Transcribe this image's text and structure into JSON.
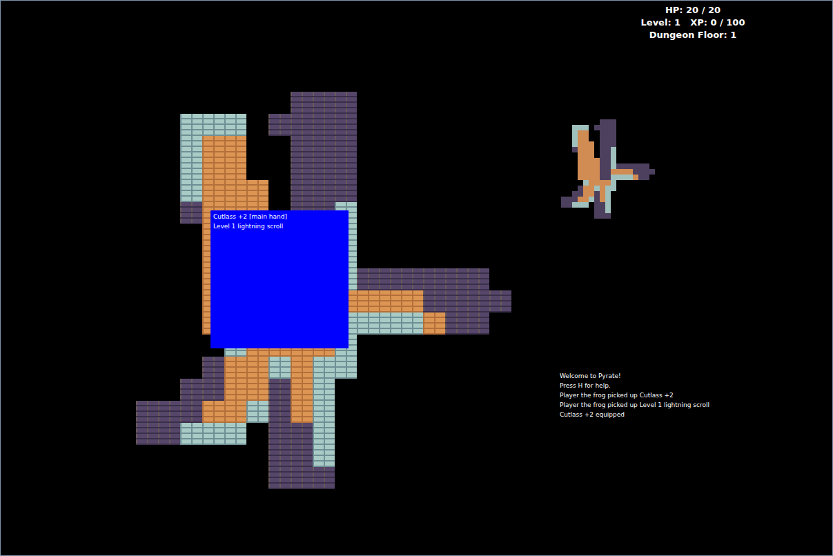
{
  "hud": {
    "hp": "HP: 20 / 20",
    "level": "Level: 1",
    "xp": "XP: 0 / 100",
    "floor": "Dungeon Floor: 1"
  },
  "map": {
    "legend": {
      "w": "wall",
      "f": "floor",
      "d": "dark",
      " ": "empty"
    },
    "rows": [
      "       ddd       ",
      "  www dddd       ",
      "  wff  ddd       ",
      "  wff  ddd       ",
      "  wfff ddd       ",
      "  dfff ddw       ",
      "   fff ddw       ",
      "   ffffddw       ",
      "   ffffddwdddddd ",
      "   ffffddffffdddd",
      "   ffffddwwwwfdd ",
      "    wffffw       ",
      "   dffwfww       ",
      "  ddffdfw        ",
      "dddffwdfw        ",
      "ddwww ddw        ",
      "      ddw        ",
      "      ddd        "
    ]
  },
  "inventory": {
    "items": [
      {
        "label": "Cutlass +2 [main hand]"
      },
      {
        "label": "Level 1 lightning scroll"
      }
    ]
  },
  "log": [
    "Welcome to Pyrate!",
    "Press H for help.",
    "Player the frog picked up Cutlass +2",
    "Player the frog picked up Level 1 lightning scroll",
    "Cutlass +2 equipped"
  ]
}
